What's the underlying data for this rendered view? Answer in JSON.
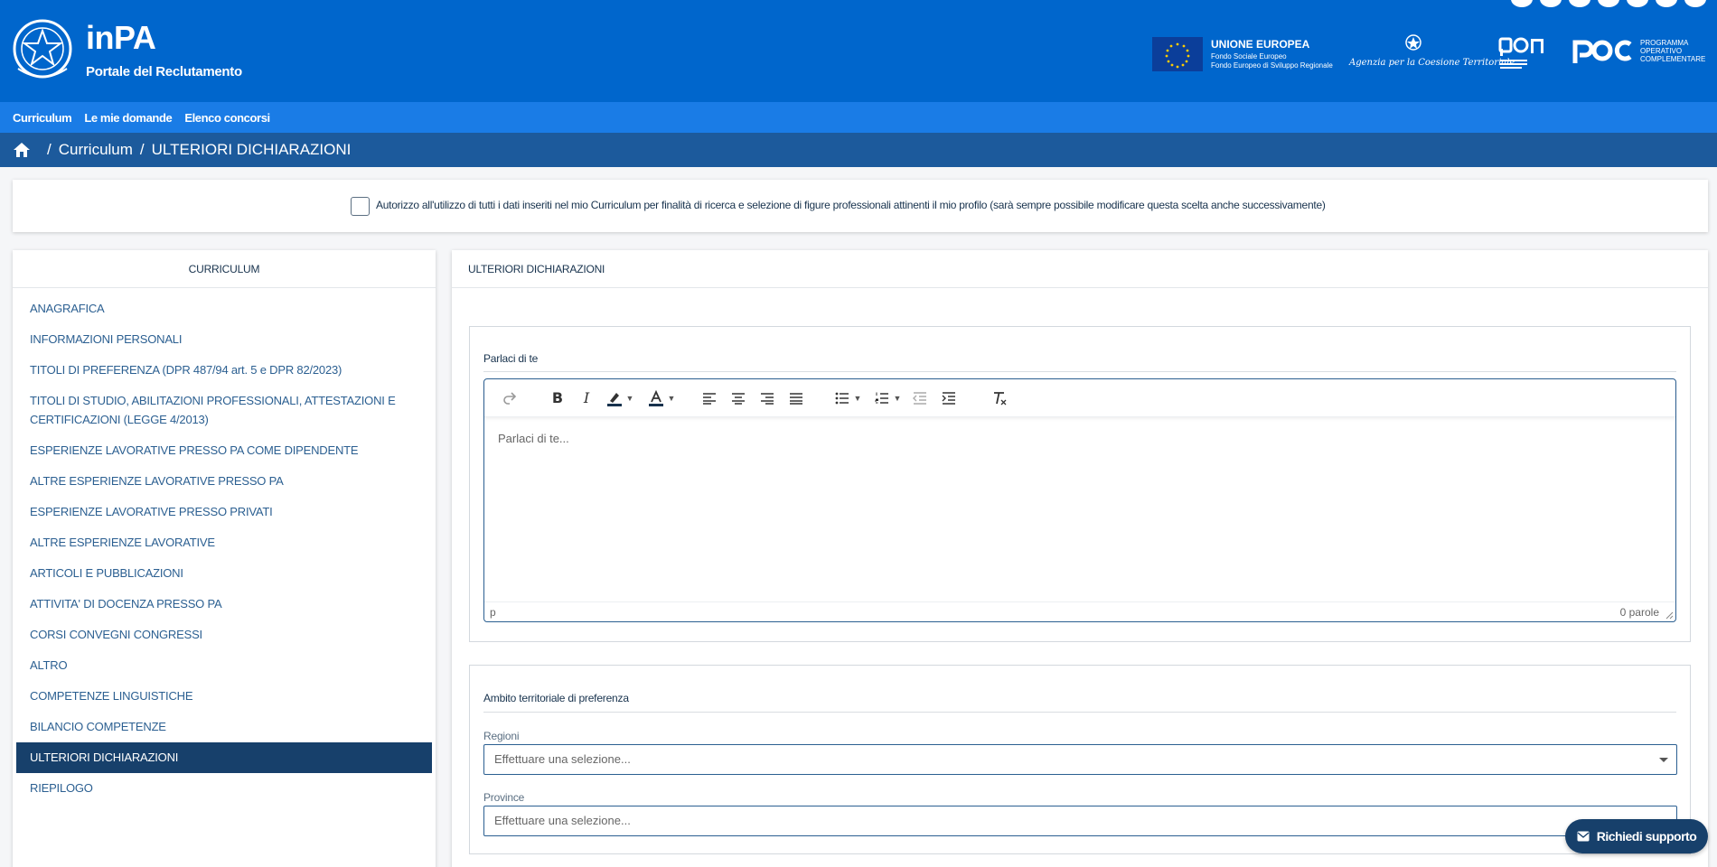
{
  "header": {
    "brand_title": "inPA",
    "brand_subtitle": "Portale del Reclutamento",
    "eu_title": "UNIONE EUROPEA",
    "eu_sub1": "Fondo Sociale Europeo",
    "eu_sub2": "Fondo Europeo di Sviluppo Regionale",
    "agency_text": "Agenzia per la Coesione Territoriale",
    "poc_text": "PROGRAMMA\nOPERATIVO\nCOMPLEMENTARE",
    "colors": {
      "primary": "#0066cc",
      "nav": "#1a7ce6",
      "breadcrumb": "#1c5a9c",
      "active": "#17406b"
    }
  },
  "nav": {
    "items": [
      "Curriculum",
      "Le mie domande",
      "Elenco concorsi"
    ]
  },
  "breadcrumb": {
    "items": [
      "Curriculum",
      "ULTERIORI DICHIARAZIONI"
    ],
    "separator": "/"
  },
  "consent": {
    "text": "Autorizzo all'utilizzo di tutti i dati inseriti nel mio Curriculum per finalità di ricerca e selezione di figure professionali attinenti il mio profilo (sarà sempre possibile modificare questa scelta anche successivamente)",
    "checked": false
  },
  "sidebar": {
    "title": "CURRICULUM",
    "items": [
      "ANAGRAFICA",
      "INFORMAZIONI PERSONALI",
      "TITOLI DI PREFERENZA (DPR 487/94 art. 5 e DPR 82/2023)",
      "TITOLI DI STUDIO, ABILITAZIONI PROFESSIONALI, ATTESTAZIONI E CERTIFICAZIONI (LEGGE 4/2013)",
      "ESPERIENZE LAVORATIVE PRESSO PA COME DIPENDENTE",
      "ALTRE ESPERIENZE LAVORATIVE PRESSO PA",
      "ESPERIENZE LAVORATIVE PRESSO PRIVATI",
      "ALTRE ESPERIENZE LAVORATIVE",
      "ARTICOLI E PUBBLICAZIONI",
      "ATTIVITA' DI DOCENZA PRESSO PA",
      "CORSI CONVEGNI CONGRESSI",
      "ALTRO",
      "COMPETENZE LINGUISTICHE",
      "BILANCIO COMPETENZE",
      "ULTERIORI DICHIARAZIONI",
      "RIEPILOGO"
    ],
    "active": "ULTERIORI DICHIARAZIONI"
  },
  "main": {
    "title": "ULTERIORI DICHIARAZIONI",
    "about": {
      "label": "Parlaci di te",
      "placeholder": "Parlaci di te...",
      "element_path": "p",
      "word_count": "0 parole",
      "toolbar_icons": [
        "redo-icon",
        "bold-icon",
        "italic-icon",
        "highlight-icon",
        "text-color-icon",
        "align-left-icon",
        "align-center-icon",
        "align-right-icon",
        "align-justify-icon",
        "bullet-list-icon",
        "numbered-list-icon",
        "outdent-icon",
        "indent-icon",
        "clear-format-icon"
      ]
    },
    "territory": {
      "label": "Ambito territoriale di preferenza",
      "regions_label": "Regioni",
      "regions_placeholder": "Effettuare una selezione...",
      "provinces_label": "Province",
      "provinces_placeholder": "Effettuare una selezione..."
    }
  },
  "support": {
    "label": "Richiedi supporto"
  }
}
